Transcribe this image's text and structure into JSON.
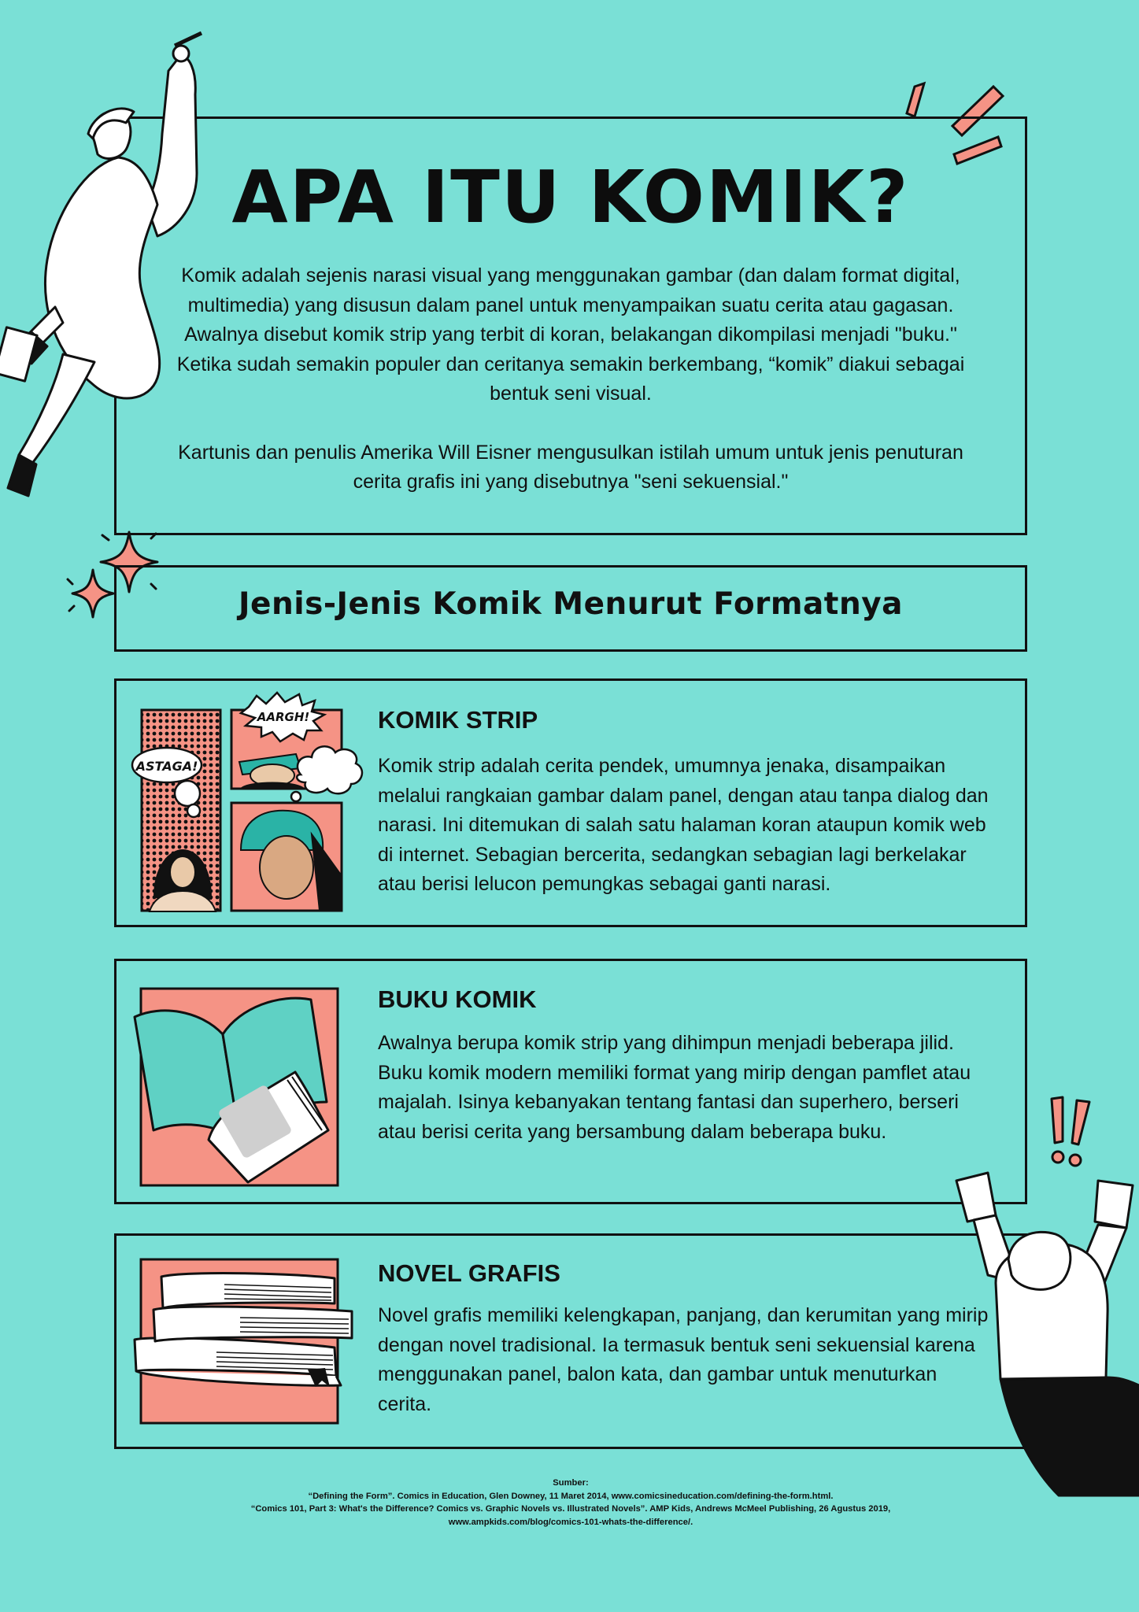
{
  "title": "APA ITU KOMIK?",
  "intro": {
    "p1": "Komik adalah sejenis narasi visual yang menggunakan gambar (dan dalam format digital, multimedia) yang disusun dalam panel untuk menyampaikan suatu cerita atau gagasan. Awalnya disebut komik strip yang terbit di koran, belakangan dikompilasi menjadi \"buku.\" Ketika sudah semakin populer dan ceritanya semakin berkembang, “komik” diakui sebagai bentuk seni visual.",
    "p2": "Kartunis dan penulis Amerika Will Eisner mengusulkan istilah umum untuk jenis penuturan cerita grafis ini yang disebutnya \"seni sekuensial.\""
  },
  "subheading": "Jenis-Jenis Komik Menurut Formatnya",
  "sections": [
    {
      "title": "KOMIK STRIP",
      "body": "Komik strip adalah cerita pendek, umumnya jenaka, disampaikan melalui rangkaian gambar dalam panel, dengan atau tanpa dialog dan narasi. Ini ditemukan di salah satu halaman koran ataupun komik web di internet. Sebagian bercerita, sedangkan sebagian lagi berkelakar atau berisi lelucon pemungkas sebagai ganti narasi.",
      "bubbles": [
        "ASTAGA!",
        "AARGH!"
      ]
    },
    {
      "title": "BUKU KOMIK",
      "body": "Awalnya berupa komik strip yang dihimpun menjadi beberapa jilid. Buku komik modern memiliki format yang mirip dengan pamflet atau majalah. Isinya kebanyakan tentang fantasi dan superhero, berseri atau berisi cerita yang bersambung dalam beberapa buku."
    },
    {
      "title": "NOVEL GRAFIS",
      "body": "Novel grafis memiliki kelengkapan, panjang, dan kerumitan yang mirip dengan novel tradisional. Ia termasuk bentuk seni sekuensial karena menggunakan panel, balon kata, dan gambar untuk menuturkan cerita."
    }
  ],
  "sources": {
    "label": "Sumber:",
    "line1": "“Defining the Form”. Comics in Education, Glen Downey, 11 Maret 2014, www.comicsineducation.com/defining-the-form.html.",
    "line2": "“Comics 101, Part 3: What's the Difference? Comics vs. Graphic Novels vs. Illustrated Novels”. AMP Kids, Andrews McMeel Publishing, 26 Agustus 2019,",
    "line3": "www.ampkids.com/blog/comics-101-whats-the-difference/."
  },
  "colors": {
    "background": "#7ae0d6",
    "accent": "#f59385",
    "ink": "#111111"
  }
}
